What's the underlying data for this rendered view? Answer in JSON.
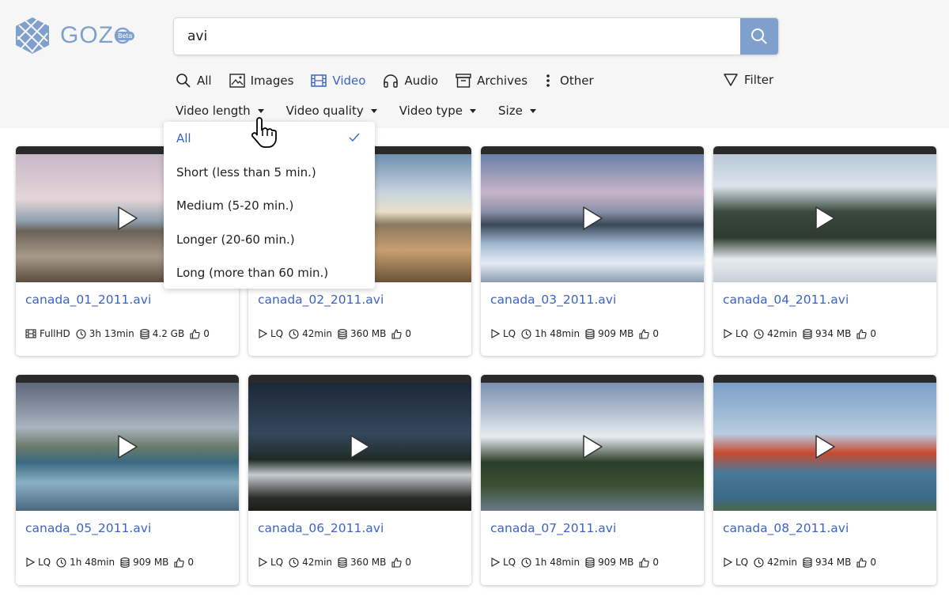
{
  "brand": {
    "name": "GOZ",
    "badge": "Beta",
    "color": "#7fa0cc",
    "accent": "#3d63c8"
  },
  "search": {
    "value": "avi",
    "placeholder": ""
  },
  "tabs": [
    {
      "label": "All",
      "icon": "search-icon"
    },
    {
      "label": "Images",
      "icon": "image-icon"
    },
    {
      "label": "Video",
      "icon": "film-icon",
      "active": true
    },
    {
      "label": "Audio",
      "icon": "headphones-icon"
    },
    {
      "label": "Archives",
      "icon": "archive-icon"
    },
    {
      "label": "Other",
      "icon": "more-vertical-icon"
    }
  ],
  "filter_label": "Filter",
  "subfilters": [
    "Video length",
    "Video quality",
    "Video type",
    "Size"
  ],
  "dropdown": {
    "items": [
      "All",
      "Short (less than 5 min.)",
      "Medium (5-20 min.)",
      "Longer (20-60 min.)",
      "Long (more than 60 min.)"
    ],
    "selected": "All"
  },
  "videos": [
    {
      "title": "canada_01_2011.avi",
      "quality": "FullHD",
      "quality_icon": "film-icon",
      "duration": "3h 13min",
      "size": "4.2 GB",
      "likes": "0"
    },
    {
      "title": "canada_02_2011.avi",
      "quality": "LQ",
      "quality_icon": "play-icon",
      "duration": "42min",
      "size": "360 MB",
      "likes": "0"
    },
    {
      "title": "canada_03_2011.avi",
      "quality": "LQ",
      "quality_icon": "play-icon",
      "duration": "1h 48min",
      "size": "909 MB",
      "likes": "0"
    },
    {
      "title": "canada_04_2011.avi",
      "quality": "LQ",
      "quality_icon": "play-icon",
      "duration": "42min",
      "size": "934 MB",
      "likes": "0"
    },
    {
      "title": "canada_05_2011.avi",
      "quality": "LQ",
      "quality_icon": "play-icon",
      "duration": "1h 48min",
      "size": "909 MB",
      "likes": "0"
    },
    {
      "title": "canada_06_2011.avi",
      "quality": "LQ",
      "quality_icon": "play-icon",
      "duration": "42min",
      "size": "360 MB",
      "likes": "0"
    },
    {
      "title": "canada_07_2011.avi",
      "quality": "LQ",
      "quality_icon": "play-icon",
      "duration": "1h 48min",
      "size": "909 MB",
      "likes": "0"
    },
    {
      "title": "canada_08_2011.avi",
      "quality": "LQ",
      "quality_icon": "play-icon",
      "duration": "42min",
      "size": "934 MB",
      "likes": "0"
    }
  ]
}
